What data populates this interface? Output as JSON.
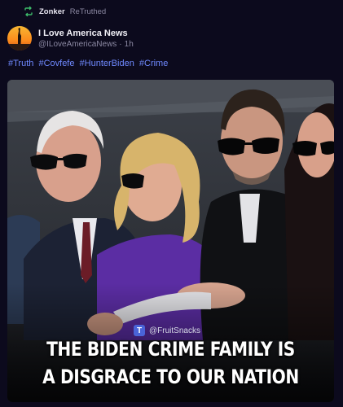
{
  "retruth": {
    "user": "Zonker",
    "verb": "ReTruthed",
    "icon": "retruth-icon"
  },
  "post": {
    "author_name": "I Love America News",
    "handle": "@ILoveAmericaNews",
    "separator": "·",
    "time": "1h",
    "avatar": "statue-of-liberty-sunset-avatar",
    "hashtags": [
      "#Truth",
      "#Covfefe",
      "#HunterBiden",
      "#Crime"
    ]
  },
  "media": {
    "description_icon": "photo-of-people-in-sunglasses",
    "watermark_badge": "T",
    "watermark_text": "@FruitSnacks",
    "caption_line1": "THE BIDEN CRIME FAMILY IS",
    "caption_line2": "A DISGRACE TO OUR NATION"
  },
  "colors": {
    "background": "#0c0a1d",
    "hashtag": "#6f89ff",
    "retruth_green": "#3dbb6a",
    "muted": "#8c89a3"
  }
}
